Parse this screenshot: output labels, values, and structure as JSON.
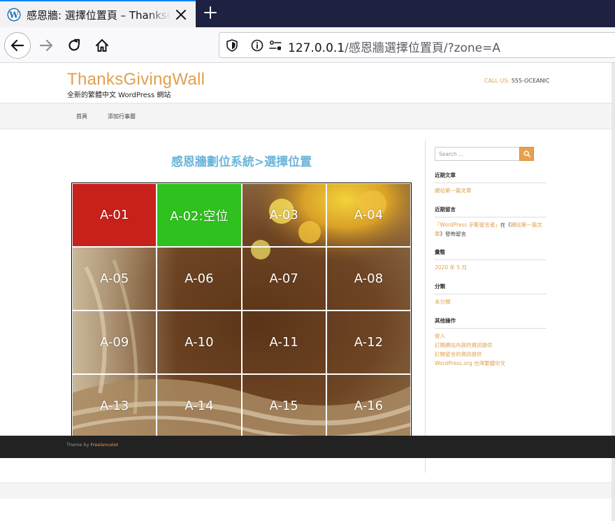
{
  "browser": {
    "tab_title": "感恩牆: 選擇位置頁 – ThanksGivingWall",
    "url_host": "127.0.0.1",
    "url_path": "/感恩牆選擇位置頁/?zone=A",
    "accent_color": "#0a84ff"
  },
  "header": {
    "site_title": "ThanksGivingWall",
    "site_description": "全新的繁體中文 WordPress 網站",
    "call_label": "CALL US:",
    "call_number": "555-OCEANIC"
  },
  "menu": {
    "home": "首頁",
    "add": "添加行事曆"
  },
  "main": {
    "title": "感恩牆劃位系統>選擇位置",
    "cells": [
      "A-01",
      "A-02:空位",
      "A-03",
      "A-04",
      "A-05",
      "A-06",
      "A-07",
      "A-08",
      "A-09",
      "A-10",
      "A-11",
      "A-12",
      "A-13",
      "A-14",
      "A-15",
      "A-16"
    ]
  },
  "sidebar": {
    "search_placeholder": "Search ...",
    "recent_posts_heading": "近期文章",
    "recent_post_1": "網站第一篇文章",
    "recent_comments_heading": "近期留言",
    "comment_author": "「WordPress 示範留言者」",
    "comment_on": "在《",
    "comment_post": "網站第一篇文章",
    "comment_tail": "》發佈留言",
    "archives_heading": "彙整",
    "archive_1": "2020 年 5 月",
    "categories_heading": "分類",
    "category_1": "未分類",
    "meta_heading": "其他操作",
    "meta_1": "登入",
    "meta_2": "訂閱網站內容的資訊提供",
    "meta_3": "訂閱留言的資訊提供",
    "meta_4": "WordPress.org 台灣繁體中文"
  },
  "footer": {
    "theme_by": "Theme by",
    "theme_name": "Freelancelot"
  },
  "colors": {
    "brand_orange": "#e0a04e",
    "title_blue": "#6db5d9",
    "cell_red": "#c8201a",
    "cell_green": "#2fc21f"
  }
}
